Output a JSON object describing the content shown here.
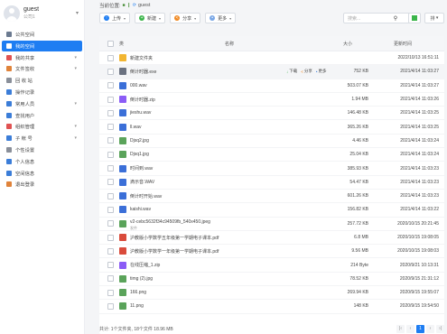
{
  "user": {
    "name": "guest",
    "company": "公司1"
  },
  "sidebar": [
    {
      "label": "公共空间",
      "icon": "public-space-icon",
      "color": "#6b7a90",
      "arrow": ""
    },
    {
      "label": "我的空间",
      "icon": "my-space-icon",
      "color": "#ffffff",
      "arrow": "",
      "active": true
    },
    {
      "label": "我的共享",
      "icon": "my-share-icon",
      "color": "#e05252",
      "arrow": "▾"
    },
    {
      "label": "文件签收",
      "icon": "sign-icon",
      "color": "#e0833a",
      "arrow": "▾"
    },
    {
      "label": "回 收 站",
      "icon": "recycle-icon",
      "color": "#8a8f99",
      "arrow": ""
    },
    {
      "label": "操作记录",
      "icon": "log-icon",
      "color": "#3b7dd8",
      "arrow": ""
    },
    {
      "label": "常用人员",
      "icon": "contacts-icon",
      "color": "#3b7dd8",
      "arrow": "▾"
    },
    {
      "label": "查找用户",
      "icon": "find-user-icon",
      "color": "#3b7dd8",
      "arrow": ""
    },
    {
      "label": "组织管理",
      "icon": "org-icon",
      "color": "#e05252",
      "arrow": "▾"
    },
    {
      "label": "子 帐 号",
      "icon": "sub-account-icon",
      "color": "#3b7dd8",
      "arrow": "▾"
    },
    {
      "label": "个性设置",
      "icon": "settings-icon",
      "color": "#8a8f99",
      "arrow": ""
    },
    {
      "label": "个人信息",
      "icon": "profile-icon",
      "color": "#3b7dd8",
      "arrow": ""
    },
    {
      "label": "空间信息",
      "icon": "space-info-icon",
      "color": "#3b7dd8",
      "arrow": ""
    },
    {
      "label": "退出登录",
      "icon": "logout-icon",
      "color": "#e0833a",
      "arrow": ""
    }
  ],
  "breadcrumb": {
    "label": "当前位置:",
    "path": "guest"
  },
  "toolbar": {
    "upload": "上传",
    "create": "新建",
    "share": "分享",
    "more": "更多",
    "search_placeholder": "搜索...",
    "sort": "排"
  },
  "table": {
    "col_type": "类",
    "col_name": "名称",
    "col_size": "大小",
    "col_time": "更新时间",
    "row_actions": {
      "download": "下载",
      "share": "分享",
      "more": "更多"
    },
    "rows": [
      {
        "name": "新建文件夹",
        "size": "",
        "time": "2022/10/13 16:51:11",
        "icon": "folder-icon",
        "color": "#f2b632"
      },
      {
        "name": "倒计时器.exe",
        "size": "752 KB",
        "time": "2021/4/14 11:03:27",
        "icon": "exe-icon",
        "color": "#6b7280",
        "hover": true
      },
      {
        "name": "000.wav",
        "size": "503.07 KB",
        "time": "2021/4/14 11:03:27",
        "icon": "audio-icon",
        "color": "#3b6fd8"
      },
      {
        "name": "倒计时器.zip",
        "size": "1.94 MB",
        "time": "2021/4/14 11:03:26",
        "icon": "zip-icon",
        "color": "#8b5cf6"
      },
      {
        "name": "jieshu.wav",
        "size": "146.48 KB",
        "time": "2021/4/14 11:03:25",
        "icon": "audio-icon",
        "color": "#3b6fd8"
      },
      {
        "name": "ll.wav",
        "size": "365.26 KB",
        "time": "2021/4/14 11:03:25",
        "icon": "audio-icon",
        "color": "#3b6fd8"
      },
      {
        "name": "Djsq2.jpg",
        "size": "4.46 KB",
        "time": "2021/4/14 11:03:24",
        "icon": "image-icon",
        "color": "#5aa35a"
      },
      {
        "name": "Djsq1.jpg",
        "size": "25.04 KB",
        "time": "2021/4/14 11:03:24",
        "icon": "image-icon",
        "color": "#5aa35a"
      },
      {
        "name": "时间到.wav",
        "size": "385.93 KB",
        "time": "2021/4/14 11:03:23",
        "icon": "audio-icon",
        "color": "#3b6fd8"
      },
      {
        "name": "滴示音.WAV",
        "size": "54.47 KB",
        "time": "2021/4/14 11:03:23",
        "icon": "audio-icon",
        "color": "#3b6fd8"
      },
      {
        "name": "倒计时开始.wav",
        "size": "601.26 KB",
        "time": "2021/4/14 11:03:23",
        "icon": "audio-icon",
        "color": "#3b6fd8"
      },
      {
        "name": "kaishi.wav",
        "size": "156.82 KB",
        "time": "2021/4/14 11:03:22",
        "icon": "audio-icon",
        "color": "#3b6fd8"
      },
      {
        "name": "v2-cebc5632f34c94509fb_540x450.jpeg",
        "sub": "发件",
        "size": "257.72 KB",
        "time": "2020/10/15 20:21:45",
        "icon": "image-icon",
        "color": "#5aa35a"
      },
      {
        "name": "沪教版小学数学五年级第一学期电子课本.pdf",
        "size": "6.8 MB",
        "time": "2020/10/15 19:08:05",
        "icon": "pdf-icon",
        "color": "#d94b3b"
      },
      {
        "name": "沪教版小学数学一年级第一学期电子课本.pdf",
        "size": "9.56 MB",
        "time": "2020/10/15 19:08:03",
        "icon": "pdf-icon",
        "color": "#d94b3b"
      },
      {
        "name": "在线压缩_1.zip",
        "size": "214 Byte",
        "time": "2020/9/21 10:13:31",
        "icon": "zip-icon",
        "color": "#8b5cf6"
      },
      {
        "name": "timg (2).jpg",
        "size": "78.52 KB",
        "time": "2020/9/15 21:31:12",
        "icon": "image-icon",
        "color": "#5aa35a"
      },
      {
        "name": "166.png",
        "size": "269.94 KB",
        "time": "2020/9/15 19:55:07",
        "icon": "image-icon",
        "color": "#5aa35a"
      },
      {
        "name": "11.png",
        "size": "148 KB",
        "time": "2020/9/15 19:54:50",
        "icon": "image-icon",
        "color": "#5aa35a"
      }
    ]
  },
  "footer": {
    "summary": "共计: 1个文件夹, 18个文件 18.96 MB",
    "page": "1"
  }
}
